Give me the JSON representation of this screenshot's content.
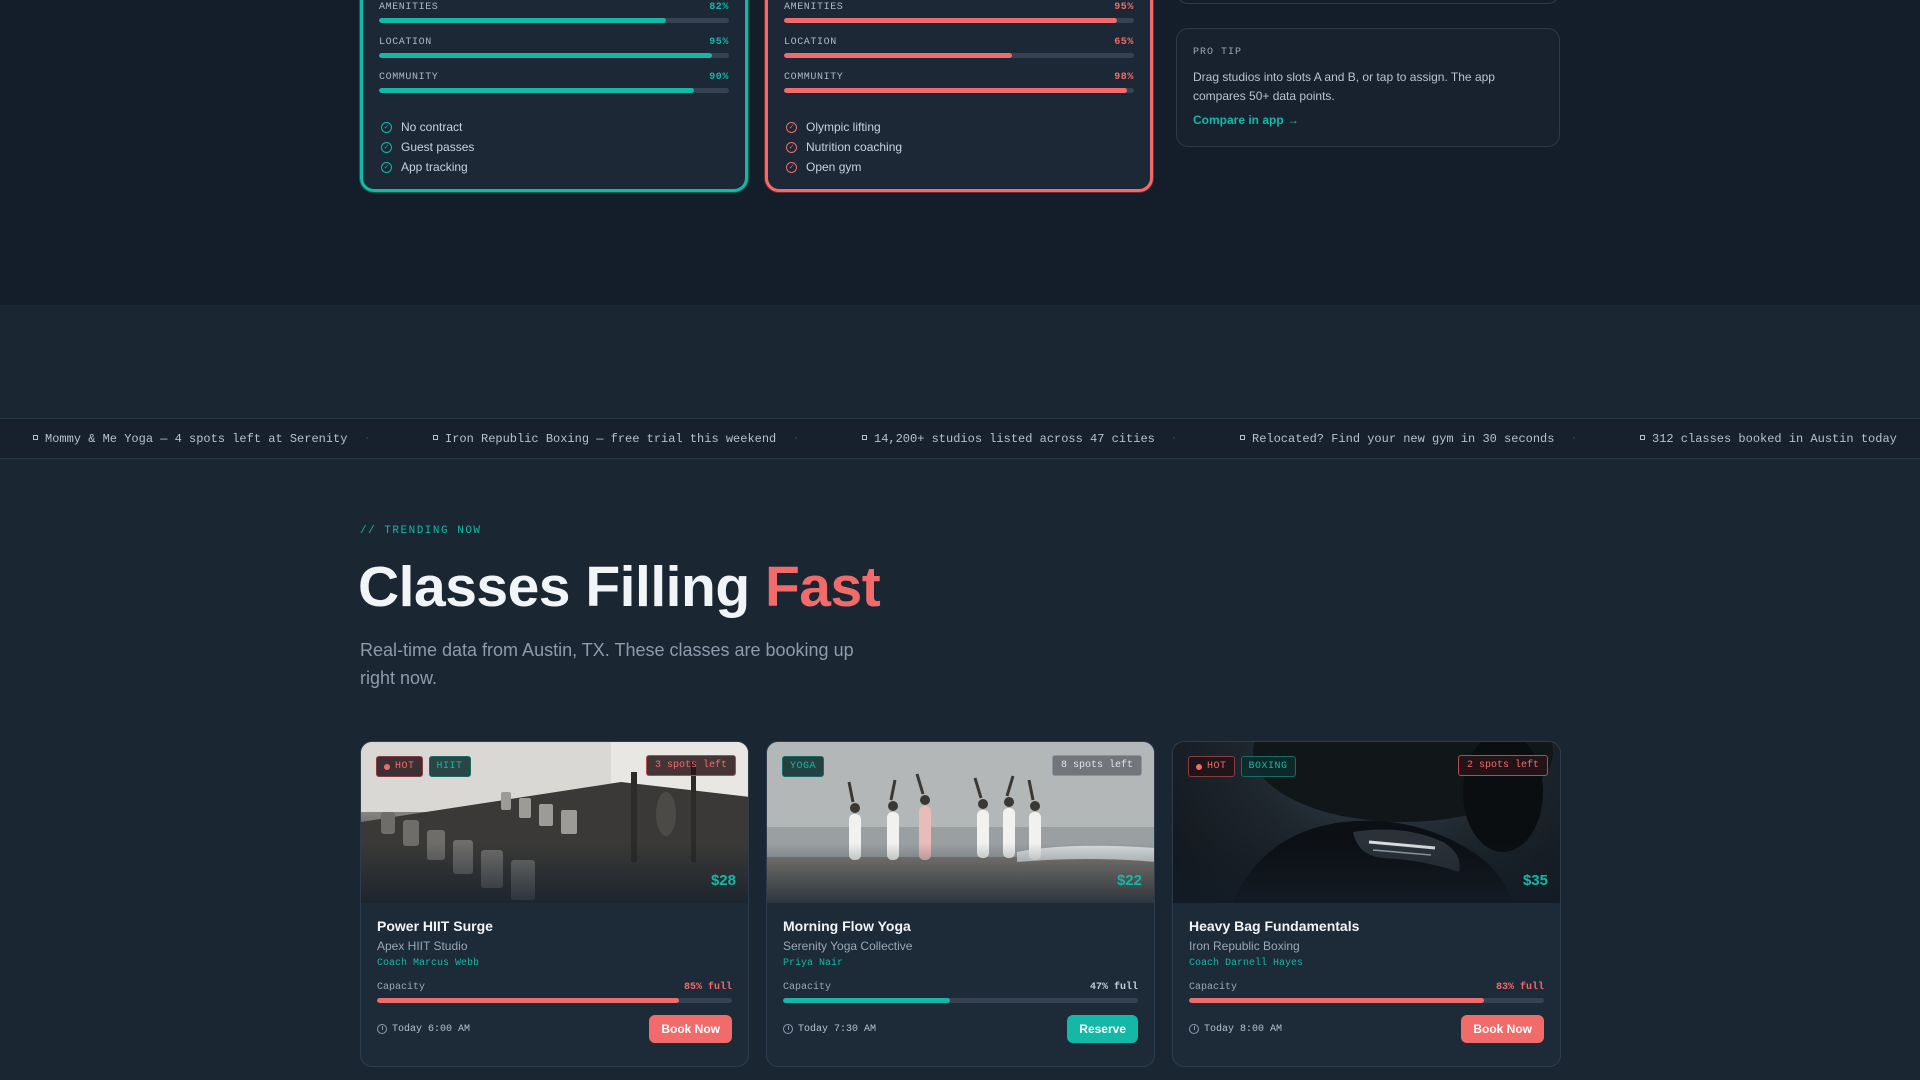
{
  "compare": {
    "card_a": {
      "metrics": [
        {
          "label": "AMENITIES",
          "value": "82%",
          "fraction": 0.82
        },
        {
          "label": "LOCATION",
          "value": "95%",
          "fraction": 0.95
        },
        {
          "label": "COMMUNITY",
          "value": "90%",
          "fraction": 0.9
        }
      ],
      "features": [
        "No contract",
        "Guest passes",
        "App tracking"
      ]
    },
    "card_b": {
      "metrics": [
        {
          "label": "AMENITIES",
          "value": "95%",
          "fraction": 0.95
        },
        {
          "label": "LOCATION",
          "value": "65%",
          "fraction": 0.65
        },
        {
          "label": "COMMUNITY",
          "value": "98%",
          "fraction": 0.98
        }
      ],
      "features": [
        "Olympic lifting",
        "Nutrition coaching",
        "Open gym"
      ]
    },
    "tip": {
      "label": "PRO TIP",
      "text": "Drag studios into slots A and B, or tap to assign. The app compares 50+ data points.",
      "link": "Compare in app →"
    }
  },
  "ticker": [
    "Mommy & Me Yoga — 4 spots left at Serenity",
    "Iron Republic Boxing — free trial this weekend",
    "14,200+ studios listed across 47 cities",
    "Relocated? Find your new gym in 30 seconds",
    "312 classes booked in Austin today"
  ],
  "trending": {
    "eyebrow": "// TRENDING NOW",
    "title_main": "Classes Filling ",
    "title_accent": "Fast",
    "subtitle": "Real-time data from Austin, TX. These classes are booking up right now.",
    "capacity_label": "Capacity",
    "classes": [
      {
        "hot": "HOT",
        "category": "HIIT",
        "spots": "3 spots left",
        "price": "$28",
        "name": "Power HIIT Surge",
        "studio": "Apex HIIT Studio",
        "coach": "Coach Marcus Webb",
        "capacity": "85% full",
        "capacity_fraction": 0.85,
        "time": "Today 6:00 AM",
        "action": "Book Now"
      },
      {
        "category": "YOGA",
        "spots": "8 spots left",
        "price": "$22",
        "name": "Morning Flow Yoga",
        "studio": "Serenity Yoga Collective",
        "coach": "Priya Nair",
        "capacity": "47% full",
        "capacity_fraction": 0.47,
        "time": "Today 7:30 AM",
        "action": "Reserve"
      },
      {
        "hot": "HOT",
        "category": "BOXING",
        "spots": "2 spots left",
        "price": "$35",
        "name": "Heavy Bag Fundamentals",
        "studio": "Iron Republic Boxing",
        "coach": "Coach Darnell Hayes",
        "capacity": "83% full",
        "capacity_fraction": 0.83,
        "time": "Today 8:00 AM",
        "action": "Book Now"
      }
    ]
  },
  "colors": {
    "teal": "#14b8a6",
    "coral": "#f26b6b",
    "background": "#1b2633"
  }
}
